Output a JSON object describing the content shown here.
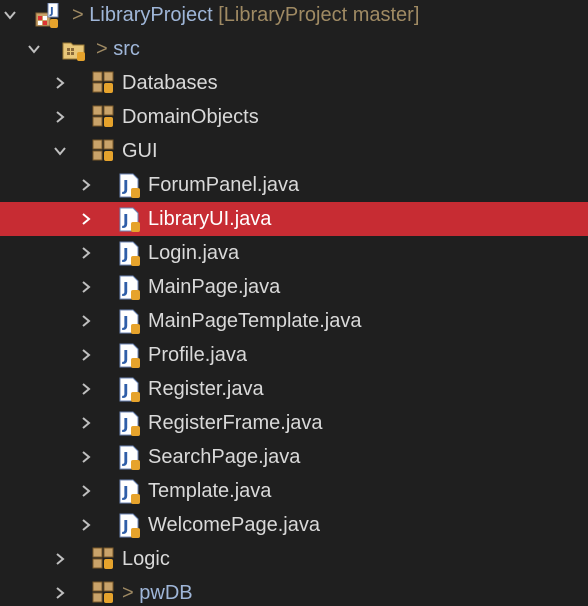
{
  "project": {
    "name": "LibraryProject",
    "repo_label": "[LibraryProject master]",
    "prefix": ">"
  },
  "src": {
    "prefix": ">",
    "name": "src"
  },
  "packages": {
    "databases": "Databases",
    "domain_objects": "DomainObjects",
    "gui": "GUI",
    "logic": "Logic",
    "pwdb_prefix": ">",
    "pwdb": "pwDB"
  },
  "gui_files": [
    "ForumPanel.java",
    "LibraryUI.java",
    "Login.java",
    "MainPage.java",
    "MainPageTemplate.java",
    "Profile.java",
    "Register.java",
    "RegisterFrame.java",
    "SearchPage.java",
    "Template.java",
    "WelcomePage.java"
  ],
  "selected_file": "LibraryUI.java",
  "colors": {
    "background": "#1f1f1f",
    "selection": "#c72c33",
    "text": "#d9d9d9",
    "decorator": "#9f8a63",
    "link_blue": "#9fb6d8"
  },
  "icons": {
    "project": "java-project-icon",
    "src": "source-folder-icon",
    "package": "package-icon",
    "java_file": "java-file-icon",
    "expanded": "chevron-down-icon",
    "collapsed": "chevron-right-icon"
  }
}
